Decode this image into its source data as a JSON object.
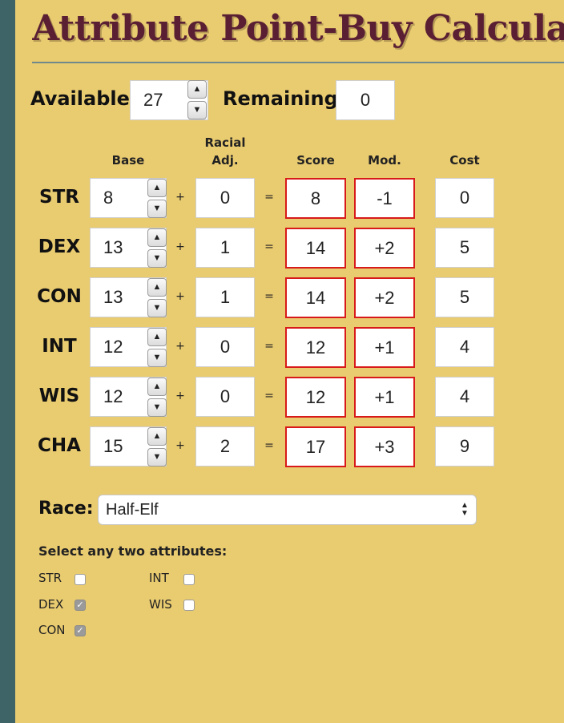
{
  "title": "Attribute Point-Buy Calculator",
  "available": {
    "label": "Available:",
    "value": "27"
  },
  "remaining": {
    "label": "Remaining:",
    "value": "0"
  },
  "columns": {
    "base": "Base",
    "racial_line1": "Racial",
    "racial_line2": "Adj.",
    "score": "Score",
    "mod": "Mod.",
    "cost": "Cost"
  },
  "operators": {
    "plus": "+",
    "equals": "="
  },
  "attributes": [
    {
      "name": "STR",
      "base": "8",
      "racial": "0",
      "score": "8",
      "mod": "-1",
      "cost": "0"
    },
    {
      "name": "DEX",
      "base": "13",
      "racial": "1",
      "score": "14",
      "mod": "+2",
      "cost": "5"
    },
    {
      "name": "CON",
      "base": "13",
      "racial": "1",
      "score": "14",
      "mod": "+2",
      "cost": "5"
    },
    {
      "name": "INT",
      "base": "12",
      "racial": "0",
      "score": "12",
      "mod": "+1",
      "cost": "4"
    },
    {
      "name": "WIS",
      "base": "12",
      "racial": "0",
      "score": "12",
      "mod": "+1",
      "cost": "4"
    },
    {
      "name": "CHA",
      "base": "15",
      "racial": "2",
      "score": "17",
      "mod": "+3",
      "cost": "9"
    }
  ],
  "race": {
    "label": "Race:",
    "selected": "Half-Elf"
  },
  "bonus_selection": {
    "prompt": "Select any two attributes:",
    "options": [
      {
        "label": "STR",
        "checked": false
      },
      {
        "label": "DEX",
        "checked": true
      },
      {
        "label": "CON",
        "checked": true
      },
      {
        "label": "INT",
        "checked": false
      },
      {
        "label": "WIS",
        "checked": false
      }
    ]
  },
  "icons": {
    "spin_up": "spin-up-icon",
    "spin_down": "spin-down-icon",
    "select_arrows": "select-arrows-icon",
    "checkmark": "checkmark-icon"
  },
  "colors": {
    "background": "#e9cb70",
    "title": "#5a1f33",
    "side_strip": "#3f6468",
    "derived_border": "#d81a1a"
  }
}
